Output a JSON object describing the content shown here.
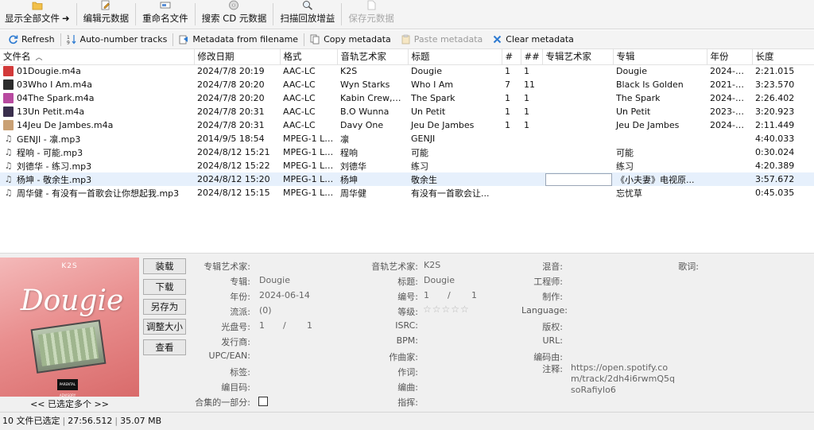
{
  "toolbar": {
    "show_all": "显示全部文件",
    "edit_metadata": "编辑元数据",
    "rename": "重命名文件",
    "search_cd": "搜索 CD 元数据",
    "scan_gain": "扫描回放增益",
    "save_metadata": "保存元数据"
  },
  "toolbar2": {
    "refresh": "Refresh",
    "auto_number": "Auto-number tracks",
    "from_filename": "Metadata from filename",
    "copy": "Copy metadata",
    "paste": "Paste metadata",
    "clear": "Clear metadata"
  },
  "columns": [
    "文件名",
    "修改日期",
    "格式",
    "音轨艺术家",
    "标题",
    "#",
    "##",
    "专辑艺术家",
    "专辑",
    "年份",
    "长度"
  ],
  "files": [
    {
      "name": "01Dougie.m4a",
      "date": "2024/7/8 20:19",
      "format": "AAC-LC",
      "artist": "K2S",
      "title": "Dougie",
      "track": "1",
      "total": "1",
      "album_artist": "",
      "album": "Dougie",
      "year": "2024-06...",
      "length": "2:21.015",
      "thumb": "#d23a3a"
    },
    {
      "name": "03Who I Am.m4a",
      "date": "2024/7/8 20:20",
      "format": "AAC-LC",
      "artist": "Wyn Starks",
      "title": "Who I Am",
      "track": "7",
      "total": "11",
      "album_artist": "",
      "album": "Black Is Golden",
      "year": "2021-09...",
      "length": "3:23.570",
      "thumb": "#2b2b2b"
    },
    {
      "name": "04The Spark.m4a",
      "date": "2024/7/8 20:20",
      "format": "AAC-LC",
      "artist": "Kabin Crew,Lis...",
      "title": "The Spark",
      "track": "1",
      "total": "1",
      "album_artist": "",
      "album": "The Spark",
      "year": "2024-06...",
      "length": "2:26.402",
      "thumb": "#b84aa0"
    },
    {
      "name": "13Un Petit.m4a",
      "date": "2024/7/8 20:31",
      "format": "AAC-LC",
      "artist": "B.O Wunna",
      "title": "Un Petit",
      "track": "1",
      "total": "1",
      "album_artist": "",
      "album": "Un Petit",
      "year": "2023-11...",
      "length": "3:20.923",
      "thumb": "#3a2f4d"
    },
    {
      "name": "14Jeu De Jambes.m4a",
      "date": "2024/7/8 20:31",
      "format": "AAC-LC",
      "artist": "Davy One",
      "title": "Jeu De Jambes",
      "track": "1",
      "total": "1",
      "album_artist": "",
      "album": "Jeu De Jambes",
      "year": "2024-04...",
      "length": "2:11.449",
      "thumb": "#c9a074"
    },
    {
      "name": "GENJI - 凛.mp3",
      "date": "2014/9/5 18:54",
      "format": "MPEG-1 La...",
      "artist": "凛",
      "title": "GENJI",
      "track": "",
      "total": "",
      "album_artist": "",
      "album": "",
      "year": "",
      "length": "4:40.033",
      "thumb": ""
    },
    {
      "name": "程响 - 可能.mp3",
      "date": "2024/8/12 15:21",
      "format": "MPEG-1 La...",
      "artist": "程响",
      "title": "可能",
      "track": "",
      "total": "",
      "album_artist": "",
      "album": "可能",
      "year": "",
      "length": "0:30.024",
      "thumb": ""
    },
    {
      "name": "刘德华 - 练习.mp3",
      "date": "2024/8/12 15:22",
      "format": "MPEG-1 La...",
      "artist": "刘德华",
      "title": "练习",
      "track": "",
      "total": "",
      "album_artist": "",
      "album": "练习",
      "year": "",
      "length": "4:20.389",
      "thumb": ""
    },
    {
      "name": "杨坤 - 敬余生.mp3",
      "date": "2024/8/12 15:20",
      "format": "MPEG-1 La...",
      "artist": "杨坤",
      "title": "敬余生",
      "track": "",
      "total": "",
      "album_artist": "",
      "album": "《小夫妻》电视原...",
      "year": "",
      "length": "3:57.672",
      "thumb": ""
    },
    {
      "name": "周华健 - 有没有一首歌会让你想起我.mp3",
      "date": "2024/8/12 15:15",
      "format": "MPEG-1 La...",
      "artist": "周华健",
      "title": "有没有一首歌会让...",
      "track": "",
      "total": "",
      "album_artist": "",
      "album": "忘忧草",
      "year": "",
      "length": "0:45.035",
      "thumb": ""
    }
  ],
  "selected_row": 8,
  "cover": {
    "brand": "K2S",
    "title": "Dougie",
    "caption": "<< 已选定多个 >>"
  },
  "side_buttons": [
    "装载",
    "下载",
    "另存为",
    "调整大小",
    "查看"
  ],
  "fields": {
    "album_artist": {
      "label": "专辑艺术家:",
      "value": ""
    },
    "album": {
      "label": "专辑:",
      "value": "Dougie"
    },
    "year": {
      "label": "年份:",
      "value": "2024-06-14"
    },
    "genre": {
      "label": "流派:",
      "value": "(0)"
    },
    "disc": {
      "label": "光盘号:",
      "value": "1",
      "total": "1"
    },
    "publisher": {
      "label": "发行商:",
      "value": ""
    },
    "upc": {
      "label": "UPC/EAN:",
      "value": ""
    },
    "label": {
      "label": "标签:",
      "value": ""
    },
    "catalog": {
      "label": "编目码:",
      "value": ""
    },
    "compilation": {
      "label": "合集的一部分:"
    },
    "track_artist": {
      "label": "音轨艺术家:",
      "value": "K2S"
    },
    "title": {
      "label": "标题:",
      "value": "Dougie"
    },
    "number": {
      "label": "编号:",
      "value": "1",
      "total": "1"
    },
    "rating": {
      "label": "等级:",
      "value": "☆☆☆☆☆"
    },
    "isrc": {
      "label": "ISRC:",
      "value": ""
    },
    "bpm": {
      "label": "BPM:",
      "value": ""
    },
    "composer": {
      "label": "作曲家:",
      "value": ""
    },
    "lyricist": {
      "label": "作词:",
      "value": ""
    },
    "arranger": {
      "label": "编曲:",
      "value": ""
    },
    "conductor": {
      "label": "指挥:",
      "value": ""
    },
    "mixer": {
      "label": "混音:",
      "value": ""
    },
    "engineer": {
      "label": "工程师:",
      "value": ""
    },
    "producer": {
      "label": "制作:",
      "value": ""
    },
    "language": {
      "label": "Language:",
      "value": ""
    },
    "copyright": {
      "label": "版权:",
      "value": ""
    },
    "url": {
      "label": "URL:",
      "value": ""
    },
    "encoded_by": {
      "label": "编码由:",
      "value": ""
    },
    "comment": {
      "label": "注释:",
      "value": "https://open.spotify.com/track/2dh4i6rwmQ5qsoRafiylo6"
    },
    "lyrics": {
      "label": "歌词:",
      "value": ""
    }
  },
  "status": {
    "count": "10 文件已选定",
    "duration": "27:56.512",
    "size": "35.07 MB"
  },
  "colors": {
    "accent": "#2e7bd1",
    "selected_row": "#e6f0fc",
    "toolbar_bg": "#f4f4f4",
    "panel_bg": "#f0f0f0"
  }
}
